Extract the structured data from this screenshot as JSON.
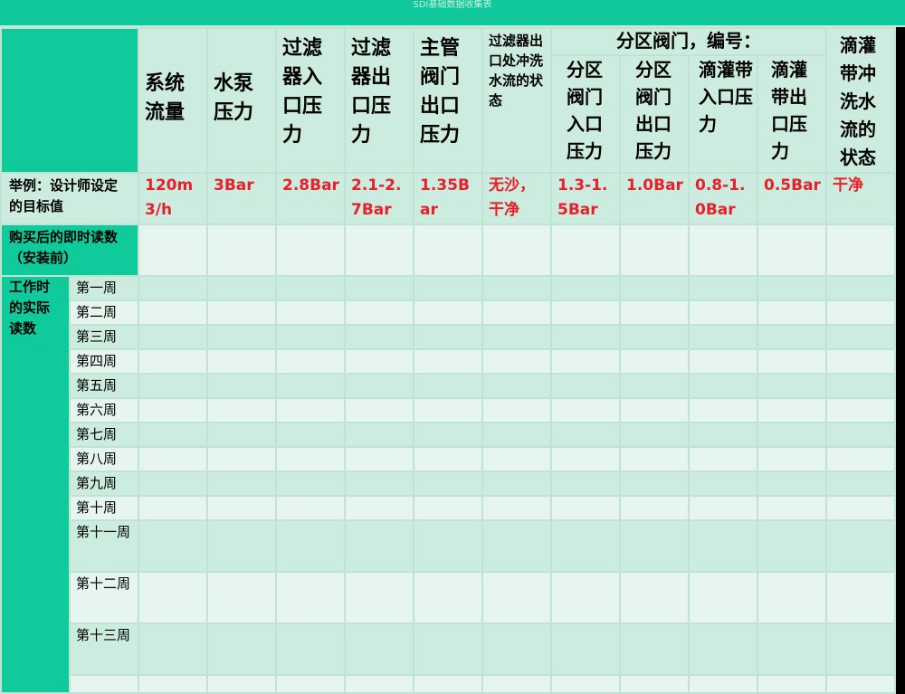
{
  "title": "SDI基础数据收集表",
  "headers": {
    "system_flow": "系统流量",
    "pump_pressure": "水泵压力",
    "filter_inlet": "过滤器入口压力",
    "filter_outlet": "过滤器出口压力",
    "main_valve_outlet": "主管阀门出口压力",
    "flush_state": "过滤器出口处冲洗水流的状态",
    "zone_group": "分区阀门，编号：",
    "zone_inlet": "分区阀门入口压力",
    "zone_outlet": "分区阀门出口压力",
    "drip_inlet": "滴灌带入口压力",
    "drip_outlet": "滴灌带出口压力",
    "drip_flush": "滴灌带冲洗水流的状态"
  },
  "example_row": {
    "label": "举例：设计师设定的目标值",
    "system_flow": "120m3/h",
    "pump_pressure": "3Bar",
    "filter_inlet": "2.8Bar",
    "filter_outlet": "2.1-2.7Bar",
    "main_valve_outlet": "1.35Bar",
    "flush_state": "无沙，干净",
    "zone_inlet": "1.3-1.5Bar",
    "zone_outlet": "1.0Bar",
    "drip_inlet": "0.8-1.0Bar",
    "drip_outlet": "0.5Bar",
    "drip_flush": "干净"
  },
  "purchase_row": {
    "label": "购买后的即时读数（安装前）"
  },
  "work_section": {
    "label": "工作时的实际读数",
    "weeks": [
      "第一周",
      "第二周",
      "第三周",
      "第四周",
      "第五周",
      "第六周",
      "第七周",
      "第八周",
      "第九周",
      "第十周",
      "第十一周",
      "第十二周",
      "第十三周"
    ]
  },
  "colors": {
    "title_bar": "#0fc89b",
    "example_text": "#e8202a",
    "header_cell": "#ccece0",
    "row_alt": "#e6f6ef",
    "label_green": "#0fcb9c"
  }
}
